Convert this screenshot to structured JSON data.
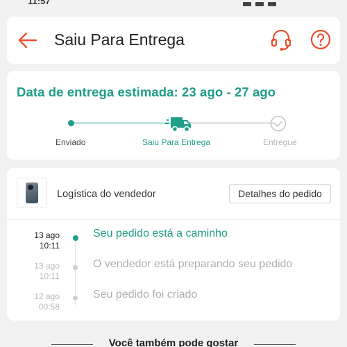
{
  "status_bar": {
    "time": "11:57"
  },
  "header": {
    "title": "Saiu Para Entrega"
  },
  "delivery": {
    "eta": "Data de entrega estimada: 23 ago - 27 ago",
    "steps": [
      {
        "label": "Enviado",
        "state": "done"
      },
      {
        "label": "Saiu Para Entrega",
        "state": "current"
      },
      {
        "label": "Entregue",
        "state": "pending"
      }
    ]
  },
  "logistics": {
    "title": "Logística do vendedor",
    "details_button": "Detalhes do pedido",
    "events": [
      {
        "date": "13 ago",
        "time": "10:11",
        "text": "Seu pedido está a caminho",
        "active": true
      },
      {
        "date": "13 ago",
        "time": "10:11",
        "text": "O vendedor está preparando seu pedido",
        "active": false
      },
      {
        "date": "12 ago",
        "time": "00:58",
        "text": "Seu pedido foi criado",
        "active": false
      }
    ]
  },
  "suggestions": {
    "title": "Você também pode gostar"
  },
  "colors": {
    "accent": "#ee4d2d",
    "teal": "#1f9e89"
  }
}
